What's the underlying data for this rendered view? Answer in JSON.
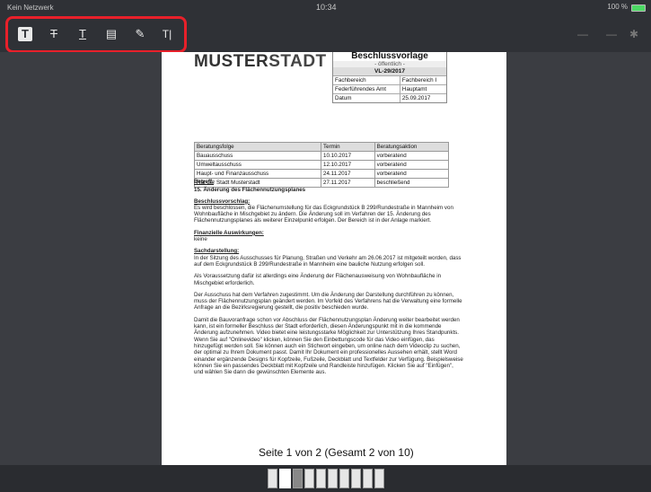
{
  "status_bar": {
    "carrier": "Kein Netzwerk",
    "time": "10:34",
    "battery": "100 %"
  },
  "toolbar": {
    "tools": [
      {
        "name": "text-box-tool",
        "glyph": "T"
      },
      {
        "name": "strikethrough-tool",
        "glyph": "T"
      },
      {
        "name": "underline-tool",
        "glyph": "T"
      },
      {
        "name": "note-tool",
        "glyph": "▤"
      },
      {
        "name": "pen-tool",
        "glyph": "✎"
      },
      {
        "name": "text-tool",
        "glyph": "T|"
      }
    ]
  },
  "document": {
    "logo_part1": "MUSTER",
    "logo_part2": "STADT",
    "header": {
      "title": "Beschlussvorlage",
      "subtitle": "- öffentlich -",
      "number": "VL-29/2017",
      "rows": [
        [
          "Fachbereich",
          "Fachbereich I"
        ],
        [
          "Federführendes Amt",
          "Hauptamt"
        ],
        [
          "Datum",
          "25.09.2017"
        ]
      ]
    },
    "beratung": {
      "headers": [
        "Beratungsfolge",
        "Termin",
        "Beratungsaktion"
      ],
      "rows": [
        [
          "Bauausschuss",
          "10.10.2017",
          "vorberatend"
        ],
        [
          "Umweltausschuss",
          "12.10.2017",
          "vorberatend"
        ],
        [
          "Haupt- und Finanzausschuss",
          "24.11.2017",
          "vorberatend"
        ],
        [
          "Rat der Stadt Musterstadt",
          "27.11.2017",
          "beschließend"
        ]
      ]
    },
    "betreff_label": "Betreff:",
    "betreff": "15. Änderung des Flächennutzungsplanes",
    "beschluss_label": "Beschlussvorschlag:",
    "beschluss_text": "Es wird beschlossen, die Flächenumstellung für das Eckgrundstück B 299/Rundestraße in Mannheim von Wohnbaufläche in Mischgebiet zu ändern. Die Änderung soll im Verfahren der 15. Änderung des Flächennutzungsplanes als weiterer Einzelpunkt erfolgen. Der Bereich ist in der Anlage markiert.",
    "finanz_label": "Finanzielle Auswirkungen:",
    "finanz_text": "keine",
    "sach_label": "Sachdarstellung:",
    "sach_p1": "In der Sitzung des Ausschusses für Planung, Straßen und Verkehr am 26.06.2017 ist mitgeteilt worden, dass auf dem Eckgrundstück B 299/Rundestraße in Mannheim eine bauliche Nutzung erfolgen soll.",
    "sach_p2": "Als Voraussetzung dafür ist allerdings eine Änderung der Flächenausweisung von Wohnbaufläche in Mischgebiet erforderlich.",
    "sach_p3": "Der Ausschuss hat dem Verfahren zugestimmt. Um die Änderung der Darstellung durchführen zu können, muss der Flächennutzungsplan geändert werden. Im Vorfeld des Verfahrens hat die Verwaltung eine formelle Anfrage an die Bezirksregierung gestellt, die positiv beschieden wurde.",
    "sach_p4": "Damit die Bauvoranfrage schon vor Abschluss der Flächennutzungsplan Änderung weiter bearbeitet werden kann, ist ein formeller Beschluss der Stadt erforderlich, diesen Änderungspunkt mit in die kommende Änderung aufzunehmen. Video bietet eine leistungsstarke Möglichkeit zur Unterstützung Ihres Standpunkts. Wenn Sie auf \"Onlinevideo\" klicken, können Sie den Einbettungscode für das Video einfügen, das hinzugefügt werden soll. Sie können auch ein Stichwort eingeben, um online nach dem Videoclip zu suchen, der optimal zu Ihrem Dokument passt. Damit Ihr Dokument ein professionelles Aussehen erhält, stellt Word einander ergänzende Designs für Kopfzeile, Fußzeile, Deckblatt und Textfelder zur Verfügung. Beispielsweise können Sie ein passendes Deckblatt mit Kopfzeile und Randleiste hinzufügen. Klicken Sie auf \"Einfügen\", und wählen Sie dann die gewünschten Elemente aus."
  },
  "page_indicator": "Seite 1 von 2 (Gesamt 2 von 10)",
  "thumbnails": {
    "count": 10,
    "selected_index": 1
  }
}
